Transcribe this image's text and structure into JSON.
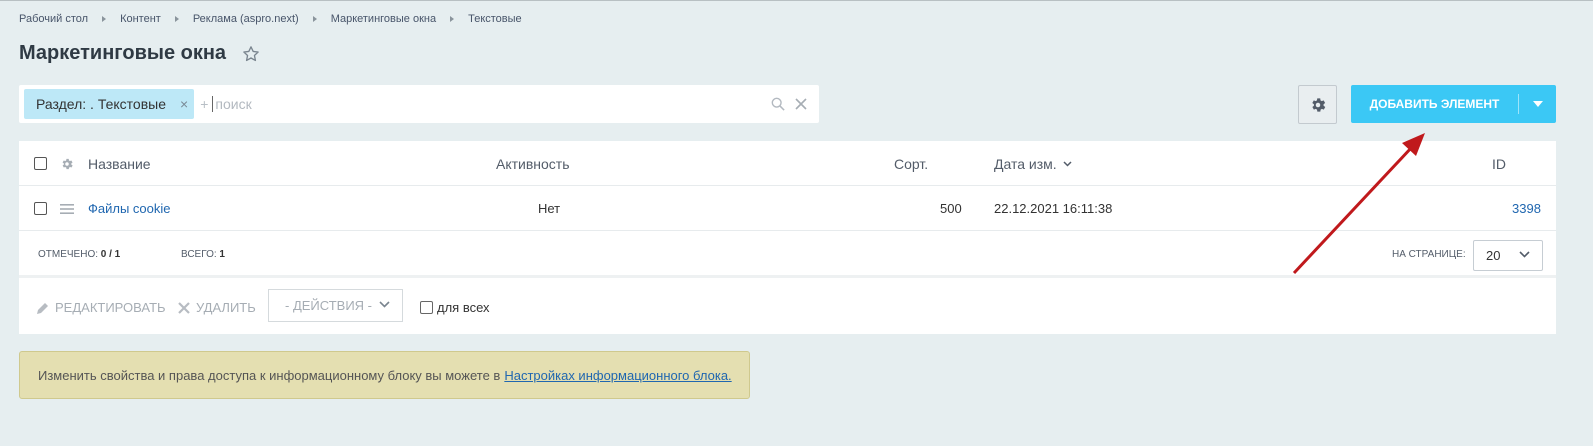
{
  "breadcrumb": [
    "Рабочий стол",
    "Контент",
    "Реклама (aspro.next)",
    "Маркетинговые окна",
    "Текстовые"
  ],
  "page_title": "Маркетинговые окна",
  "filter": {
    "tag_label": "Раздел: . Текстовые",
    "plus": "+",
    "placeholder": "поиск"
  },
  "add_button": {
    "label": "ДОБАВИТЬ ЭЛЕМЕНТ"
  },
  "table": {
    "columns": {
      "name": "Название",
      "activity": "Активность",
      "sort": "Сорт.",
      "date": "Дата изм.",
      "id": "ID"
    },
    "rows": [
      {
        "name": "Файлы cookie",
        "activity": "Нет",
        "sort": "500",
        "date": "22.12.2021 16:11:38",
        "id": "3398"
      }
    ]
  },
  "footer": {
    "selected_label": "ОТМЕЧЕНО:",
    "selected_value": "0 / 1",
    "total_label": "ВСЕГО:",
    "total_value": "1",
    "per_page_label": "НА СТРАНИЦЕ:",
    "per_page_value": "20"
  },
  "actions": {
    "edit": "РЕДАКТИРОВАТЬ",
    "delete": "УДАЛИТЬ",
    "select_placeholder": "- ДЕЙСТВИЯ -",
    "for_all": "для всех"
  },
  "info": {
    "text": "Изменить свойства и права доступа к информационному блоку вы можете в",
    "link": "Настройках информационного блока."
  },
  "colors": {
    "accent": "#3bc8f5",
    "tag_bg": "#bde8f7",
    "link": "#2067b0",
    "info_bg": "#e4dfb1",
    "annotation_arrow": "#c0191c"
  }
}
